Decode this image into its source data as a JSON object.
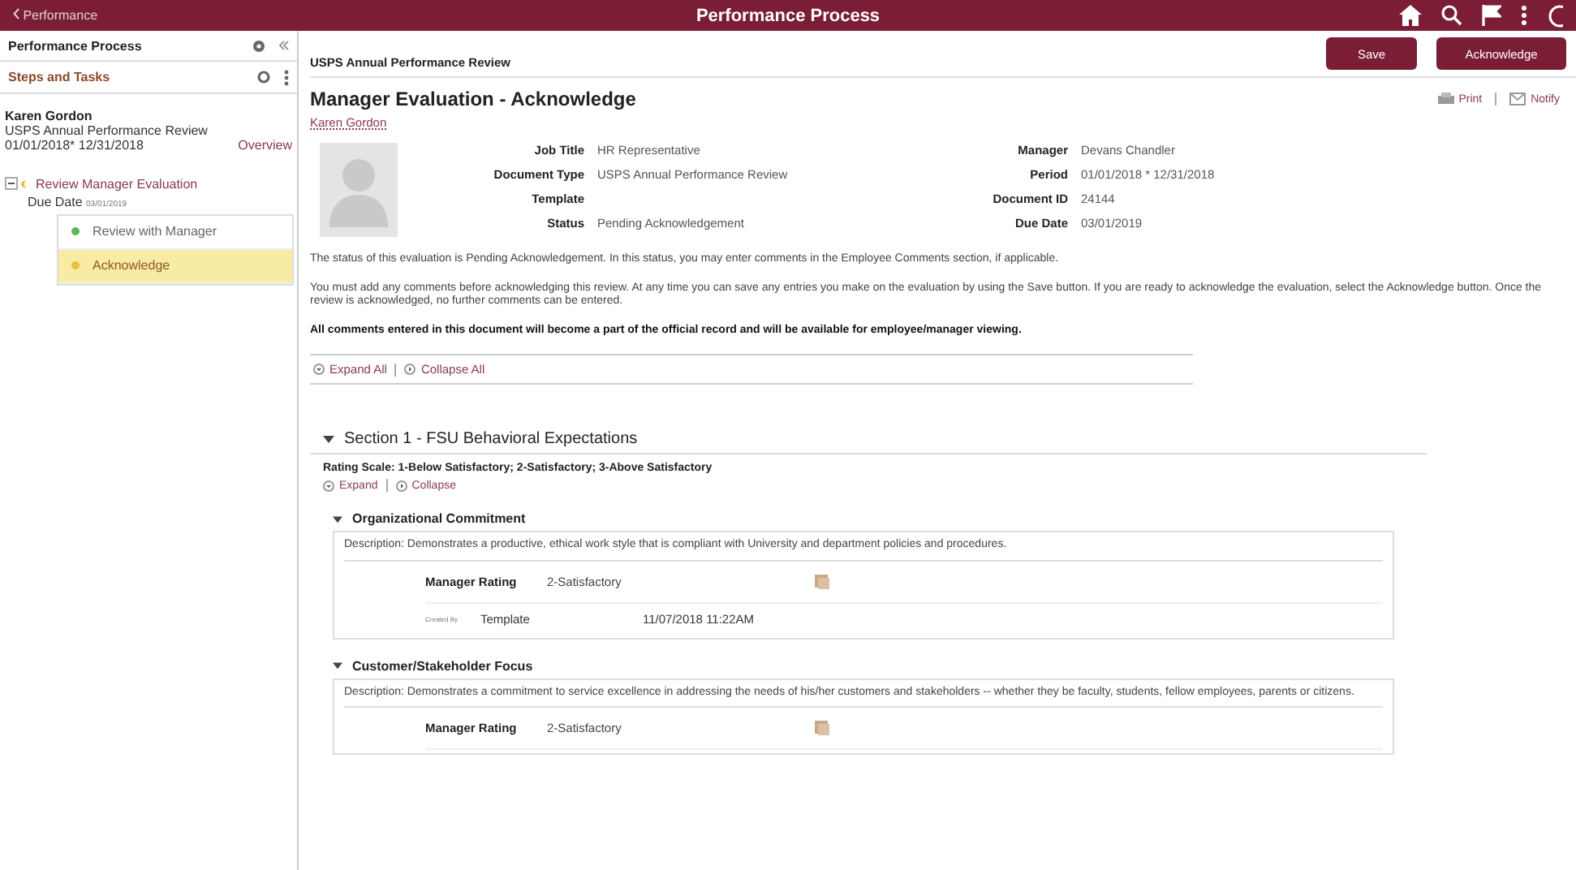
{
  "topbar": {
    "back": "Performance",
    "title": "Performance Process"
  },
  "sidebar": {
    "title": "Performance Process",
    "subtitle": "Steps and Tasks",
    "employee": "Karen Gordon",
    "document": "USPS Annual Performance Review",
    "period": "01/01/2018*  12/31/2018",
    "overview": "Overview",
    "step": {
      "label": "Review Manager Evaluation",
      "expanded": true,
      "due_label": "Due Date",
      "due": "03/01/2019",
      "children": [
        {
          "label": "Review with Manager",
          "color": "#5cb85c",
          "selected": false
        },
        {
          "label": "Acknowledge",
          "color": "#e8c13a",
          "selected": true
        }
      ]
    }
  },
  "header": {
    "breadcrumb": "USPS Annual Performance Review",
    "buttons": [
      "Save",
      "Acknowledge"
    ]
  },
  "page": {
    "title": "Manager Evaluation - Acknowledge",
    "employee": "Karen Gordon",
    "print": "Print",
    "notify": "Notify",
    "fields_left": [
      {
        "label": "Job Title",
        "value": "HR Representative"
      },
      {
        "label": "Document Type",
        "value": "USPS Annual Performance Review"
      },
      {
        "label": "Template"
      },
      {
        "label": "Status",
        "value": "Pending Acknowledgement"
      }
    ],
    "fields_right": [
      {
        "label": "Manager",
        "value": "Devans Chandler"
      },
      {
        "label": "Period",
        "value": "01/01/2018  *    12/31/2018"
      },
      {
        "label": "Document ID",
        "value": "24144"
      },
      {
        "label": "Due Date",
        "value": "03/01/2019"
      }
    ],
    "paragraphs": [
      {
        "text": "The status of this evaluation is Pending Acknowledgement. In this status, you may enter comments in the Employee Comments section, if applicable.",
        "bold": false
      },
      {
        "text": "You must add any comments before acknowledging this review. At any time you can save any entries you make on the evaluation by using the Save button. If you are ready to acknowledge the evaluation, select the Acknowledge button. Once the review is acknowledged, no further comments can be entered.",
        "bold": false
      },
      {
        "text": "All comments entered in this document will become a part of the official record and will be available for employee/manager viewing.",
        "bold": true
      }
    ],
    "expand_all": "Expand All",
    "collapse_all": "Collapse All"
  },
  "section": {
    "title": "Section 1 - FSU Behavioral Expectations",
    "expanded": true,
    "scale": "Rating Scale: 1-Below Satisfactory; 2-Satisfactory; 3-Above Satisfactory",
    "expand": "Expand",
    "collapse": "Collapse",
    "items": [
      {
        "title": "Organizational Commitment",
        "expanded": true,
        "description": "Description: Demonstrates a productive, ethical work style that is compliant with University and department policies and procedures.",
        "rating_label": "Manager Rating",
        "rating": "2-Satisfactory",
        "created_by_label": "Created By",
        "created_by": "Template",
        "created_at": "11/07/2018 11:22AM"
      },
      {
        "title": "Customer/Stakeholder Focus",
        "expanded": true,
        "description": "Description: Demonstrates a commitment to service excellence in addressing the needs of his/her customers and stakeholders -- whether they be faculty, students, fellow employees, parents or citizens.",
        "rating_label": "Manager Rating",
        "rating": "2-Satisfactory"
      }
    ]
  }
}
